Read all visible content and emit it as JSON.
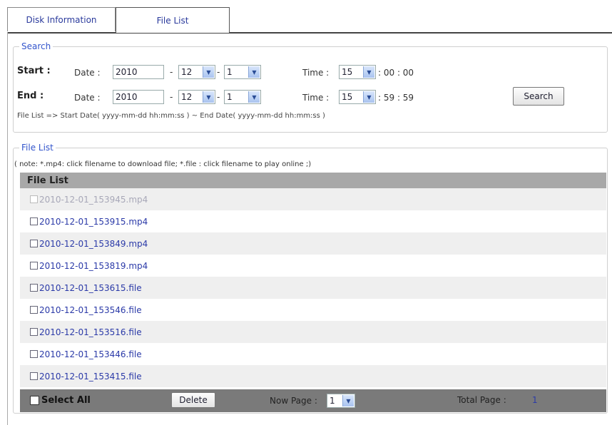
{
  "tabs": [
    {
      "label": "Disk Information",
      "active": false
    },
    {
      "label": "File List",
      "active": true
    }
  ],
  "search": {
    "legend": "Search",
    "start": {
      "label": "Start :",
      "date_label": "Date :",
      "year": "2010",
      "month": "12",
      "day": "1",
      "time_label": "Time :",
      "hour": "15",
      "min_sec": ": 00 : 00"
    },
    "end": {
      "label": "End :",
      "date_label": "Date :",
      "year": "2010",
      "month": "12",
      "day": "1",
      "time_label": "Time :",
      "hour": "15",
      "min_sec": ": 59 : 59"
    },
    "dash": "-",
    "button_label": "Search",
    "hint": "File List => Start Date( yyyy-mm-dd hh:mm:ss ) ~ End Date( yyyy-mm-dd hh:mm:ss )"
  },
  "file_list": {
    "legend": "File List",
    "note": "( note: *.mp4: click filename to download file; *.file : click filename to play online ;)",
    "header": "File List",
    "files": [
      {
        "name": "2010-12-01_153945.mp4",
        "disabled": true
      },
      {
        "name": "2010-12-01_153915.mp4",
        "disabled": false
      },
      {
        "name": "2010-12-01_153849.mp4",
        "disabled": false
      },
      {
        "name": "2010-12-01_153819.mp4",
        "disabled": false
      },
      {
        "name": "2010-12-01_153615.file",
        "disabled": false
      },
      {
        "name": "2010-12-01_153546.file",
        "disabled": false
      },
      {
        "name": "2010-12-01_153516.file",
        "disabled": false
      },
      {
        "name": "2010-12-01_153446.file",
        "disabled": false
      },
      {
        "name": "2010-12-01_153415.file",
        "disabled": false
      }
    ],
    "footer": {
      "select_all": "Select All",
      "delete": "Delete",
      "now_page_label": "Now Page :",
      "now_page_value": "1",
      "total_page_label": "Total Page :",
      "total_page_value": "1"
    }
  },
  "colors": {
    "link": "#2b3aa8",
    "header_bg": "#a8a8a8",
    "footer_bg": "#7a7a7a",
    "legend": "#3355cc"
  }
}
